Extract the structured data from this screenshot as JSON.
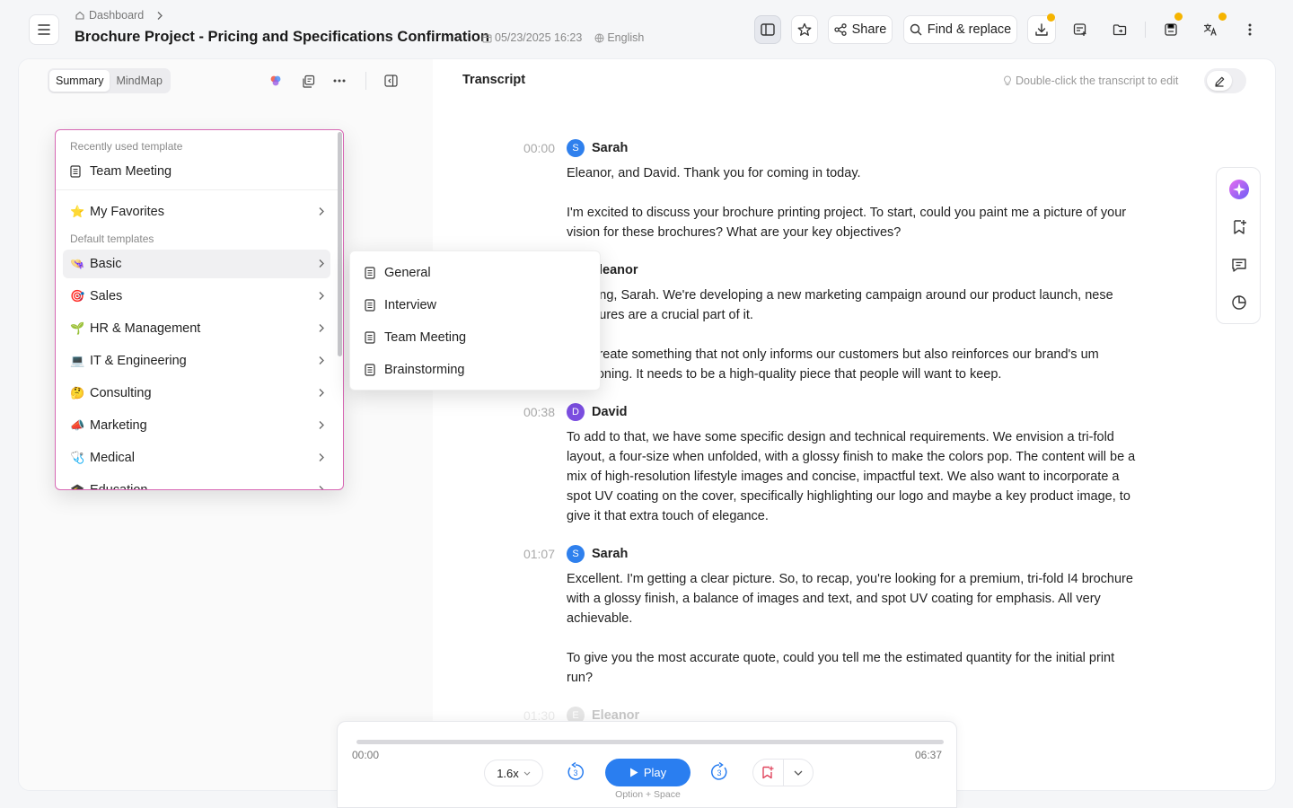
{
  "breadcrumb": {
    "label": "Dashboard"
  },
  "document": {
    "title": "Brochure Project - Pricing and Specifications Confirmation",
    "date": "05/23/2025 16:23",
    "language": "English"
  },
  "toolbar": {
    "share_label": "Share",
    "find_replace_label": "Find & replace"
  },
  "left_panel": {
    "tabs": [
      "Summary",
      "MindMap"
    ]
  },
  "transcript": {
    "title": "Transcript",
    "edit_hint": "Double-click the transcript to edit",
    "entries": [
      {
        "time": "00:00",
        "speaker": "Sarah",
        "initial": "S",
        "color": "#2f80ed",
        "paragraphs": [
          "Eleanor, and David. Thank you for coming in today.",
          "I'm excited to discuss your brochure printing project. To start, could you paint me a picture of your vision for these brochures? What are your key objectives?"
        ]
      },
      {
        "time": "",
        "speaker": "leanor",
        "initial": "",
        "paragraphs": [
          "morning, Sarah. We're developing a new marketing campaign around our product launch, nese brochures are a crucial part of it.",
          "n to create something that not only informs our customers but also reinforces our brand's um positioning. It needs to be a high-quality piece that people will want to keep."
        ]
      },
      {
        "time": "00:38",
        "speaker": "David",
        "initial": "D",
        "color": "#7b4ee0",
        "paragraphs": [
          "To add to that, we have some specific design and technical requirements. We envision a tri-fold layout, a four-size when unfolded, with a glossy finish to make the colors pop. The content will be a mix of high-resolution lifestyle images and concise, impactful text. We also want to incorporate a spot UV coating on the cover, specifically highlighting our logo and maybe a key product image, to give it that extra touch of elegance."
        ]
      },
      {
        "time": "01:07",
        "speaker": "Sarah",
        "initial": "S",
        "color": "#2f80ed",
        "paragraphs": [
          "Excellent. I'm getting a clear picture. So, to recap, you're looking for a premium, tri-fold I4 brochure with a glossy finish, a balance of images and text, and spot UV coating for emphasis. All very achievable.",
          "To give you the most accurate quote, could you tell me the estimated quantity for the initial print run?"
        ]
      },
      {
        "time": "01:30",
        "speaker": "Eleanor",
        "initial": "E",
        "color": "#999999",
        "paragraphs": []
      }
    ]
  },
  "template_menu": {
    "recent_label": "Recently used template",
    "recent_item": "Team Meeting",
    "favorites": "My Favorites",
    "default_label": "Default templates",
    "categories": [
      {
        "emoji": "👒",
        "label": "Basic"
      },
      {
        "emoji": "🎯",
        "label": "Sales"
      },
      {
        "emoji": "🌱",
        "label": "HR & Management"
      },
      {
        "emoji": "💻",
        "label": "IT & Engineering"
      },
      {
        "emoji": "🤔",
        "label": "Consulting"
      },
      {
        "emoji": "📣",
        "label": "Marketing"
      },
      {
        "emoji": "🩺",
        "label": "Medical"
      },
      {
        "emoji": "🎓",
        "label": "Education"
      }
    ],
    "submenu": [
      "General",
      "Interview",
      "Team Meeting",
      "Brainstorming"
    ]
  },
  "player": {
    "current": "00:00",
    "total": "06:37",
    "speed": "1.6x",
    "skip_back": "3",
    "skip_forward": "3",
    "play_label": "Play",
    "shortcut": "Option + Space",
    "progress": 0.0
  },
  "colors": {
    "accent": "#2a7ef0",
    "dropdown_border": "#d768b4",
    "badge": "#f5b400"
  }
}
